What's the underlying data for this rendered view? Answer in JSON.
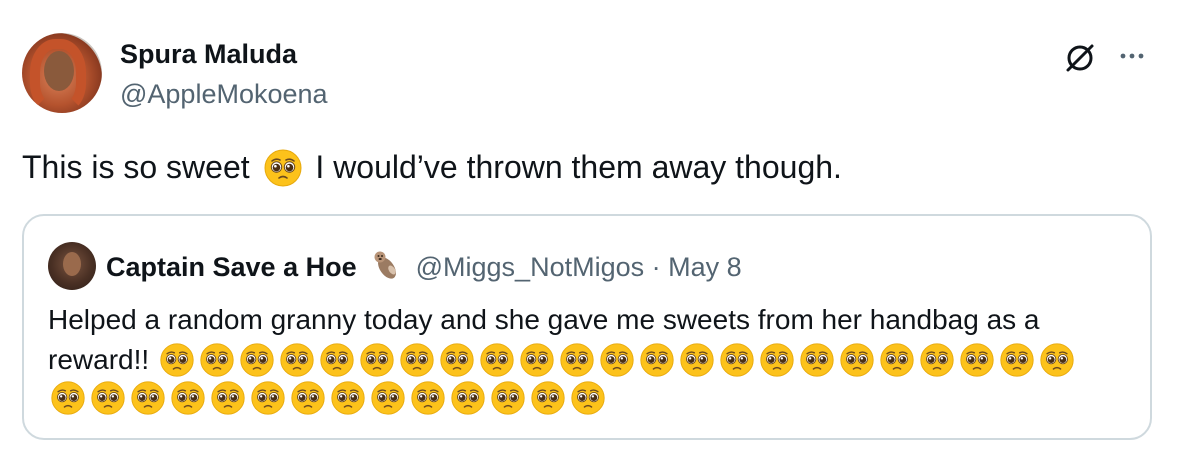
{
  "author": {
    "name": "Spura Maluda",
    "handle": "@AppleMokoena"
  },
  "tweet": {
    "text_before": "This is so sweet",
    "text_after": "I would’ve thrown them away though.",
    "emoji": "pleading-face"
  },
  "quoted_tweet": {
    "name": "Captain Save a Hoe",
    "name_emoji": "otter",
    "handle": "@Miggs_NotMigos",
    "separator": "·",
    "date": "May 8",
    "text": "Helped a random granny today and she gave me sweets from her handbag as a reward!!",
    "emoji_line1_count": 23,
    "emoji_line2_count": 14,
    "emoji": "pleading-face"
  },
  "icons": {
    "grok": "grok-icon",
    "more": "more-options-icon"
  },
  "colors": {
    "text": "#0f1419",
    "secondary": "#536471",
    "border": "#cfd9de",
    "emoji_face": "#fcc21b"
  }
}
